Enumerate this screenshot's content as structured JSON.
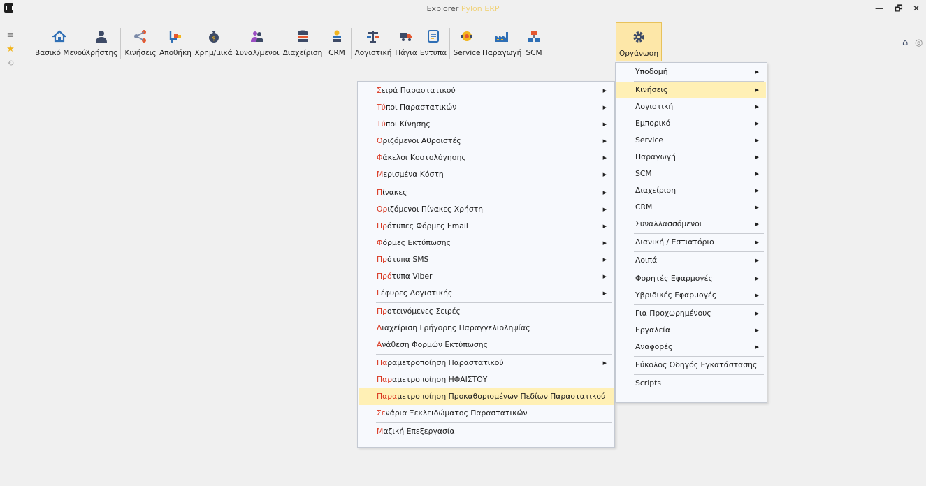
{
  "window": {
    "title": "Explorer",
    "brand": "Pylon ERP",
    "minimize": "—",
    "maximize": "🗗",
    "close": "✕"
  },
  "rail": {
    "menu_icon": "≡",
    "favorites_icon": "★",
    "history_icon": "⟲"
  },
  "ribbon": {
    "items": [
      {
        "label": "Βασικό Μενού",
        "icon": "home-icon"
      },
      {
        "label": "Χρήστης",
        "icon": "user-icon"
      },
      {
        "label": "Κινήσεις",
        "icon": "share-icon"
      },
      {
        "label": "Αποθήκη",
        "icon": "warehouse-icon"
      },
      {
        "label": "Χρημ/μικά",
        "icon": "money-bag-icon"
      },
      {
        "label": "Συναλ/μενοι",
        "icon": "people-icon"
      },
      {
        "label": "Διαχείριση",
        "icon": "database-icon"
      },
      {
        "label": "CRM",
        "icon": "crm-icon"
      },
      {
        "label": "Λογιστική",
        "icon": "balance-icon"
      },
      {
        "label": "Πάγια",
        "icon": "truck-icon"
      },
      {
        "label": "Εντυπα",
        "icon": "form-icon"
      },
      {
        "label": "Service",
        "icon": "service-icon"
      },
      {
        "label": "Παραγωγή",
        "icon": "factory-icon"
      },
      {
        "label": "SCM",
        "icon": "scm-icon"
      },
      {
        "label": "Οργάνωση",
        "icon": "gear-icon"
      }
    ]
  },
  "top_right": {
    "home_icon": "⌂",
    "globe_icon": "◎"
  },
  "submenu": {
    "items": [
      {
        "hot": "Σ",
        "rest": "ειρά Παραστατικού",
        "arrow": true
      },
      {
        "hot": "Τύ",
        "rest": "ποι Παραστατικών",
        "arrow": true
      },
      {
        "hot": "Τύ",
        "rest": "ποι Κίνησης",
        "arrow": true
      },
      {
        "hot": "Ο",
        "rest": "ριζόμενοι Αθροιστές",
        "arrow": true
      },
      {
        "hot": "Φ",
        "rest": "άκελοι Κοστολόγησης",
        "arrow": true
      },
      {
        "hot": "Μ",
        "rest": "ερισμένα Κόστη",
        "arrow": true
      },
      {
        "hot": "Π",
        "rest": "ίνακες",
        "arrow": true
      },
      {
        "hot": "Ορ",
        "rest": "ιζόμενοι Πίνακες Χρήστη",
        "arrow": true
      },
      {
        "hot": "Πρ",
        "rest": "ότυπες Φόρμες Email",
        "arrow": true
      },
      {
        "hot": "Φ",
        "rest": "όρμες Εκτύπωσης",
        "arrow": true
      },
      {
        "hot": "Πρ",
        "rest": "ότυπα SMS",
        "arrow": true
      },
      {
        "hot": "Πρό",
        "rest": "τυπα Viber",
        "arrow": true
      },
      {
        "hot": "Γ",
        "rest": "έφυρες Λογιστικής",
        "arrow": true
      },
      {
        "hot": "Πρ",
        "rest": "οτεινόμενες Σειρές",
        "arrow": false
      },
      {
        "hot": "Δ",
        "rest": "ιαχείριση Γρήγορης Παραγγελιοληψίας",
        "arrow": false
      },
      {
        "hot": "Α",
        "rest": "νάθεση Φορμών Εκτύπωσης",
        "arrow": false
      },
      {
        "hot": "Πα",
        "rest": "ραμετροποίηση Παραστατικού",
        "arrow": true
      },
      {
        "hot": "Παρ",
        "rest": "αμετροποίηση ΗΦΑΙΣΤΟΥ",
        "arrow": false
      },
      {
        "hot": "Παρα",
        "rest": "μετροποίηση Προκαθορισμένων Πεδίων Παραστατικού",
        "arrow": false
      },
      {
        "hot": "Σε",
        "rest": "νάρια Ξεκλειδώματος Παραστατικών",
        "arrow": false
      },
      {
        "hot": "Μ",
        "rest": "αζική Επεξεργασία",
        "arrow": false
      }
    ]
  },
  "mainmenu": {
    "items": [
      {
        "label": "Υποδομή",
        "arrow": true
      },
      {
        "label": "Κινήσεις",
        "arrow": true
      },
      {
        "label": "Λογιστική",
        "arrow": true
      },
      {
        "label": "Εμπορικό",
        "arrow": true
      },
      {
        "label": "Service",
        "arrow": true
      },
      {
        "label": "Παραγωγή",
        "arrow": true
      },
      {
        "label": "SCM",
        "arrow": true
      },
      {
        "label": "Διαχείριση",
        "arrow": true
      },
      {
        "label": "CRM",
        "arrow": true
      },
      {
        "label": "Συναλλασσόμενοι",
        "arrow": true
      },
      {
        "label": "Λιανική / Εστιατόριο",
        "arrow": true
      },
      {
        "label": "Λοιπά",
        "arrow": true
      },
      {
        "label": "Φορητές Εφαρμογές",
        "arrow": true
      },
      {
        "label": "Υβριδικές Εφαρμογές",
        "arrow": true
      },
      {
        "label": "Για Προχωρημένους",
        "arrow": true
      },
      {
        "label": "Εργαλεία",
        "arrow": true
      },
      {
        "label": "Αναφορές",
        "arrow": true
      },
      {
        "label": "Εύκολος Οδηγός Εγκατάστασης",
        "arrow": false
      },
      {
        "label": "Scripts",
        "arrow": false
      }
    ]
  },
  "arrow_glyph": "▶"
}
